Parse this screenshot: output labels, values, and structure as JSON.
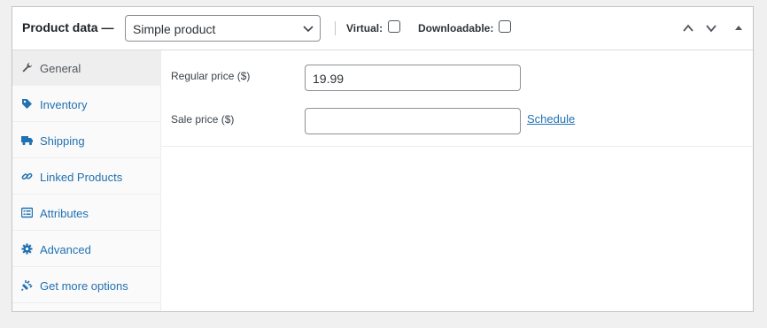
{
  "header": {
    "title": "Product data —",
    "product_type": "Simple product",
    "virtual_label": "Virtual:",
    "virtual_checked": false,
    "downloadable_label": "Downloadable:",
    "downloadable_checked": false,
    "icons": [
      "move-up-icon",
      "move-down-icon",
      "toggle-panel-icon"
    ]
  },
  "tabs": [
    {
      "label": "General",
      "icon": "wrench-icon",
      "active": true
    },
    {
      "label": "Inventory",
      "icon": "tag-icon",
      "active": false
    },
    {
      "label": "Shipping",
      "icon": "truck-icon",
      "active": false
    },
    {
      "label": "Linked Products",
      "icon": "link-icon",
      "active": false
    },
    {
      "label": "Attributes",
      "icon": "list-icon",
      "active": false
    },
    {
      "label": "Advanced",
      "icon": "gear-icon",
      "active": false
    },
    {
      "label": "Get more options",
      "icon": "plugin-icon",
      "active": false
    }
  ],
  "general": {
    "regular_price_label": "Regular price ($)",
    "regular_price_value": "19.99",
    "sale_price_label": "Sale price ($)",
    "sale_price_value": "",
    "schedule_link": "Schedule"
  },
  "colors": {
    "link": "#2271b1",
    "border": "#c3c4c7",
    "active_tab_bg": "#eeeeee"
  }
}
